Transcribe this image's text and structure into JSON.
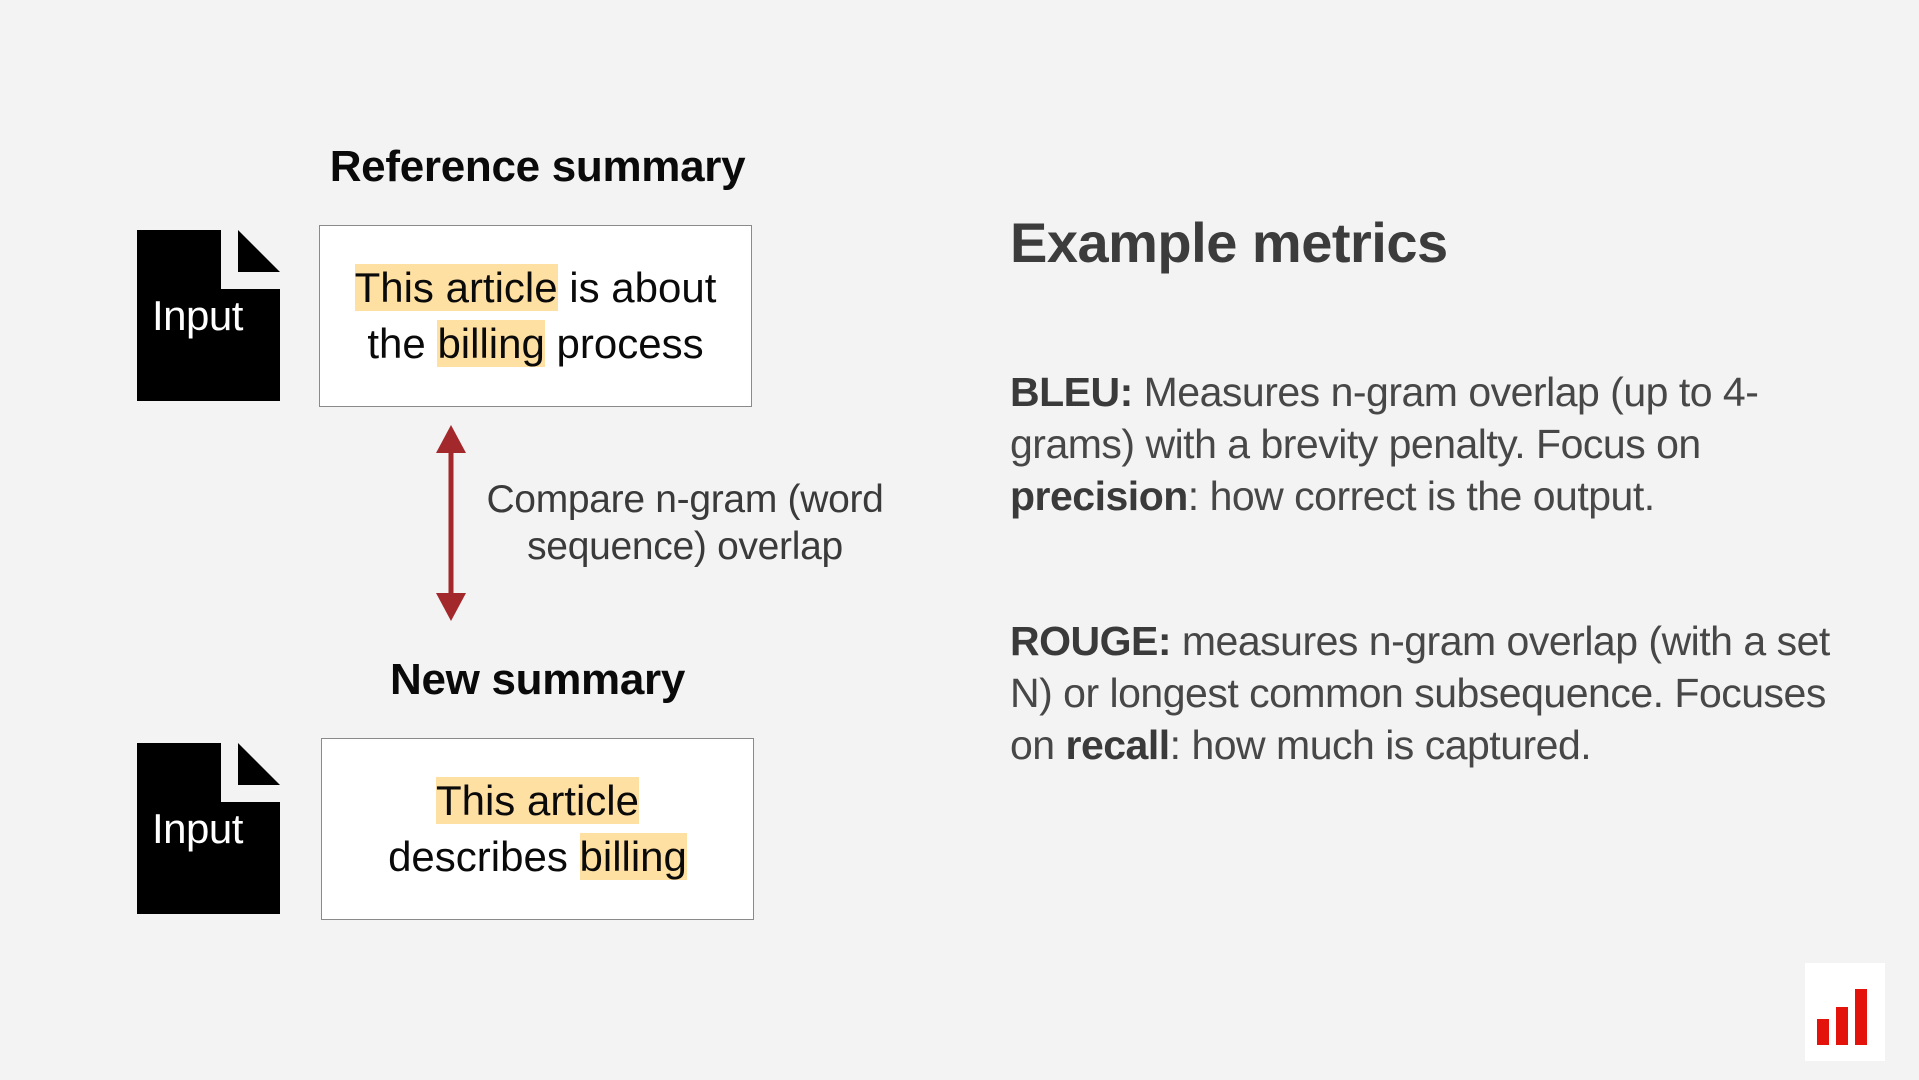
{
  "reference": {
    "heading": "Reference summary",
    "input_label": "Input",
    "text_parts": [
      {
        "t": "This article",
        "h": true
      },
      {
        "t": " is about",
        "h": false
      },
      {
        "t": "the ",
        "h": false,
        "br": true
      },
      {
        "t": "billing",
        "h": true
      },
      {
        "t": " process",
        "h": false
      }
    ]
  },
  "new_summary": {
    "heading": "New summary",
    "input_label": "Input",
    "text_parts": [
      {
        "t": "This article",
        "h": true
      },
      {
        "t": "describes ",
        "h": false,
        "br": true
      },
      {
        "t": "billing",
        "h": true
      }
    ]
  },
  "compare": {
    "line1": "Compare n-gram (word",
    "line2": "sequence) overlap"
  },
  "metrics": {
    "title": "Example metrics",
    "bleu": {
      "label": "BLEU:",
      "text1": " Measures n-gram overlap (up to 4-grams) with a brevity penalty. Focus on ",
      "emph": "precision",
      "text2": ": how correct is the output."
    },
    "rouge": {
      "label": "ROUGE:",
      "text1": " measures n-gram overlap (with a set N) or longest common subsequence. Focuses on ",
      "emph": "recall",
      "text2": ": how much is captured."
    }
  },
  "colors": {
    "highlight": "#ffe0a3",
    "arrow": "#a3282b",
    "logo_bars": "#e3120b"
  },
  "icons": [
    "document-icon",
    "double-arrow-icon",
    "bar-chart-logo-icon"
  ]
}
